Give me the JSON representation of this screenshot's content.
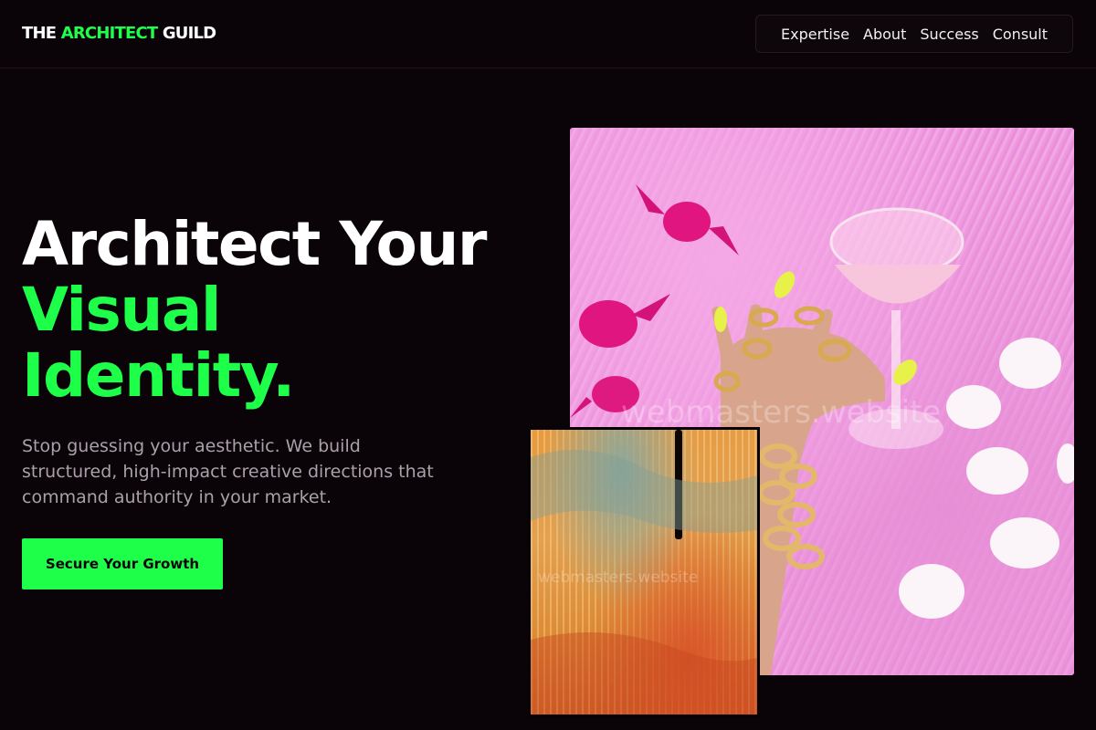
{
  "header": {
    "logo": {
      "part1": "THE ",
      "part2": "ARCHITECT",
      "part3": " GUILD"
    },
    "nav": [
      "Expertise",
      "About",
      "Success",
      "Consult"
    ]
  },
  "hero": {
    "title_line1": "Architect Your",
    "title_line2": "Visual",
    "title_line3": "Identity.",
    "subtitle": "Stop guessing your aesthetic. We build structured, high-impact creative directions that command authority in your market.",
    "cta_label": "Secure Your Growth"
  },
  "images": {
    "main_alt": "Hand with gold rings holding pink cocktail glass on pink fur with pink candies and white petals",
    "art_alt": "Abstract orange and gold textured painting with black drip",
    "watermark": "webmasters.website"
  },
  "colors": {
    "background": "#0a0409",
    "accent": "#1eff4a",
    "subtitle": "#a9a1a8"
  }
}
